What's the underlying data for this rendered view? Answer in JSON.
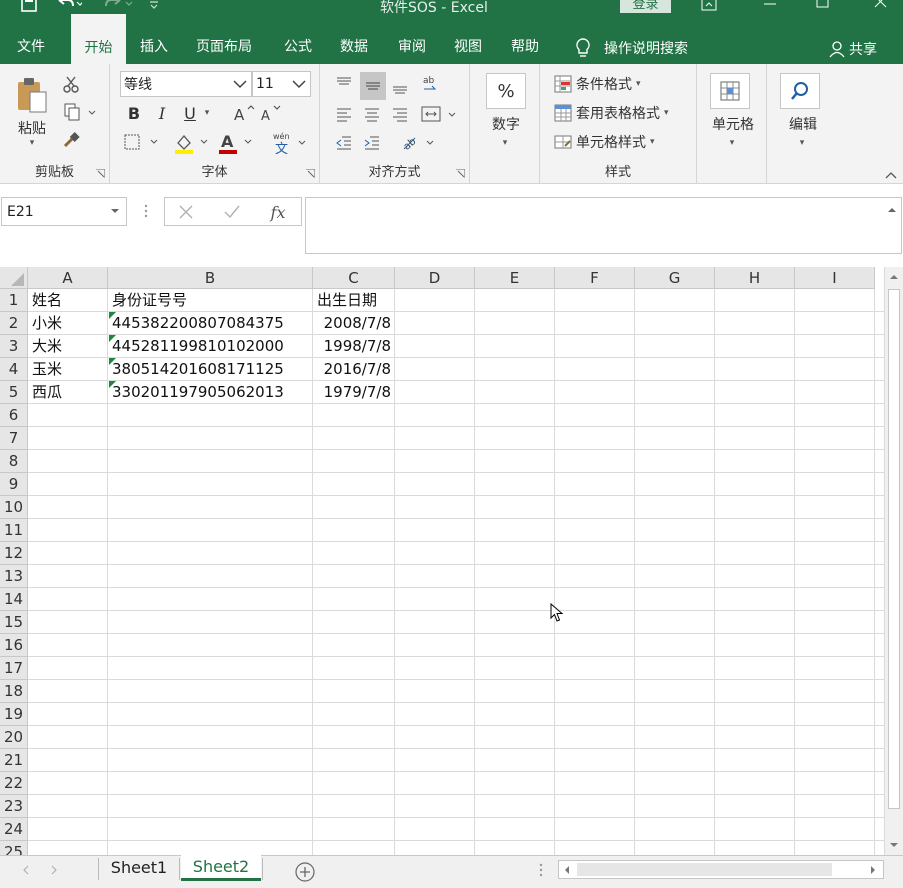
{
  "app": {
    "title": "软件SOS  -  Excel",
    "login_label": "登录"
  },
  "menu": {
    "tabs": [
      "文件",
      "开始",
      "插入",
      "页面布局",
      "公式",
      "数据",
      "审阅",
      "视图",
      "帮助"
    ],
    "active_tab": "开始",
    "tell_me": "操作说明搜索",
    "share": "共享"
  },
  "ribbon": {
    "clipboard": {
      "label": "剪贴板",
      "paste_label": "粘贴"
    },
    "font": {
      "label": "字体",
      "font_name": "等线",
      "font_size": "11",
      "bold": "B",
      "italic": "I",
      "underline": "U"
    },
    "alignment": {
      "label": "对齐方式"
    },
    "number": {
      "label": "数字",
      "percent": "%"
    },
    "styles": {
      "label": "样式",
      "conditional": "条件格式",
      "table_format": "套用表格格式",
      "cell_styles": "单元格样式"
    },
    "cells": {
      "label": "单元格"
    },
    "editing": {
      "label": "编辑"
    }
  },
  "formula_bar": {
    "name_box": "E21",
    "fx": "fx",
    "formula": ""
  },
  "sheet": {
    "columns": [
      "A",
      "B",
      "C",
      "D",
      "E",
      "F",
      "G",
      "H",
      "I"
    ],
    "row_numbers": [
      "1",
      "2",
      "3",
      "4",
      "5",
      "6",
      "7",
      "8",
      "9",
      "10",
      "11",
      "12",
      "13",
      "14",
      "15",
      "16",
      "17",
      "18",
      "19",
      "20",
      "21",
      "22",
      "23",
      "24",
      "25"
    ],
    "headers": {
      "name": "姓名",
      "id": "身份证号号",
      "dob": "出生日期"
    },
    "rows": [
      {
        "name": "小米",
        "id": "445382200807084375",
        "dob": "2008/7/8"
      },
      {
        "name": "大米",
        "id": "445281199810102000",
        "dob": "1998/7/8"
      },
      {
        "name": "玉米",
        "id": "380514201608171125",
        "dob": "2016/7/8"
      },
      {
        "name": "西瓜",
        "id": "330201197905062013",
        "dob": "1979/7/8"
      }
    ]
  },
  "sheet_tabs": {
    "tabs": [
      "Sheet1",
      "Sheet2"
    ],
    "active": "Sheet2"
  },
  "colors": {
    "excel_green": "#217346",
    "active_tab_bg": "#f3f3f3"
  }
}
